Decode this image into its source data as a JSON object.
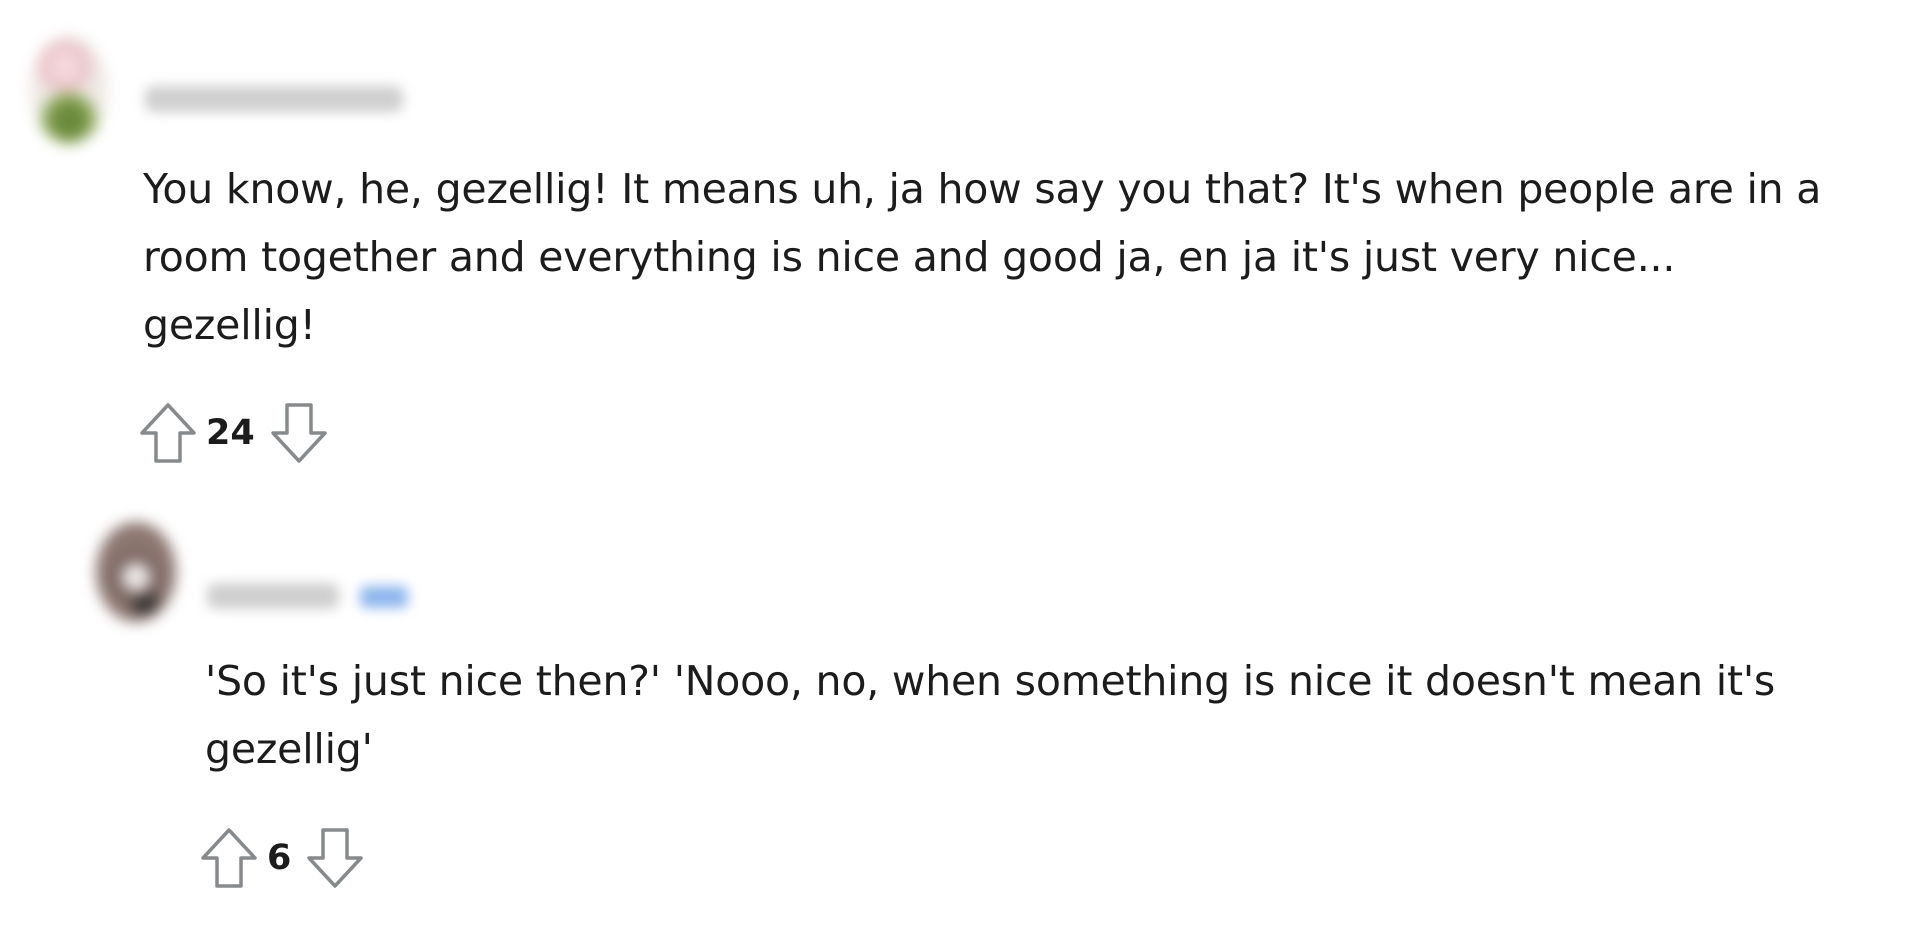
{
  "thread": {
    "comments": [
      {
        "author": "Dictord_of_Dix",
        "body_lines": [
          "You know, he, gezellig! It means uh, ja how say you that? It's when people are in a",
          "room together and everything is nice and good ja, en ja it's just very nice...",
          "gezellig!"
        ],
        "score": "24",
        "upvote_icon": "arrow-up-outline-icon",
        "downvote_icon": "arrow-down-outline-icon"
      },
      {
        "author": "reflexes",
        "badge": "OP",
        "body_lines": [
          "'So it's just nice then?' 'Nooo, no, when something is nice it doesn't mean it's",
          "gezellig'"
        ],
        "score": "6",
        "upvote_icon": "arrow-up-outline-icon",
        "downvote_icon": "arrow-down-outline-icon"
      }
    ]
  },
  "colors": {
    "text": "#1c1c1c",
    "icon_stroke": "#878a8c",
    "op_badge": "#0079d3"
  }
}
